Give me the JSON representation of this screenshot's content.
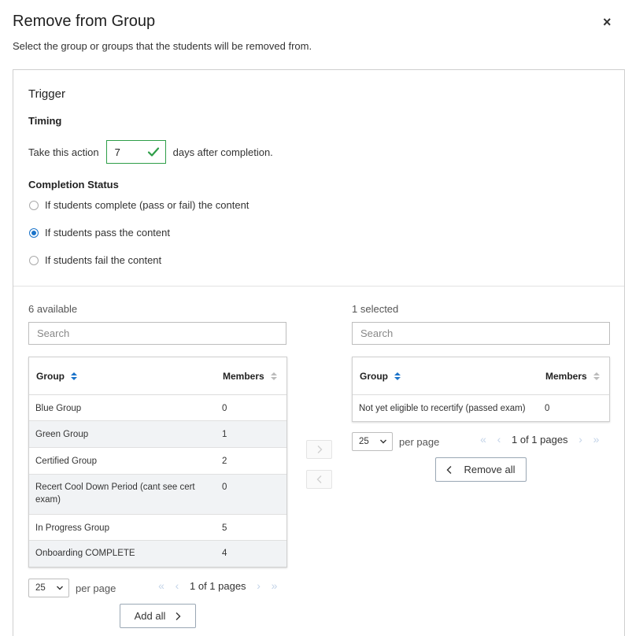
{
  "dialog": {
    "title": "Remove from Group",
    "close": "×",
    "subtitle": "Select the group or groups that the students will be removed from."
  },
  "trigger": {
    "section_label": "Trigger",
    "timing_label": "Timing",
    "action_prefix": "Take this action",
    "days_value": "7",
    "action_suffix": "days after completion.",
    "status_label": "Completion Status",
    "options": [
      {
        "label": "If students complete (pass or fail) the content",
        "selected": false
      },
      {
        "label": "If students pass the content",
        "selected": true
      },
      {
        "label": "If students fail the content",
        "selected": false
      }
    ]
  },
  "available": {
    "count_label": "6 available",
    "search_placeholder": "Search",
    "headers": {
      "group": "Group",
      "members": "Members"
    },
    "rows": [
      {
        "group": "Blue Group",
        "members": "0"
      },
      {
        "group": "Green Group",
        "members": "1"
      },
      {
        "group": "Certified Group",
        "members": "2"
      },
      {
        "group": "Recert Cool Down Period (cant see cert exam)",
        "members": "0"
      },
      {
        "group": "In Progress Group",
        "members": "5"
      },
      {
        "group": "Onboarding COMPLETE",
        "members": "4"
      }
    ],
    "per_page_value": "25",
    "per_page_label": "per page",
    "pages_label": "1 of 1 pages",
    "add_all_label": "Add all"
  },
  "selected": {
    "count_label": "1 selected",
    "search_placeholder": "Search",
    "headers": {
      "group": "Group",
      "members": "Members"
    },
    "rows": [
      {
        "group": "Not yet eligible to recertify (passed exam)",
        "members": "0"
      }
    ],
    "per_page_value": "25",
    "per_page_label": "per page",
    "pages_label": "1 of 1 pages",
    "remove_all_label": "Remove all"
  },
  "colors": {
    "accent": "#1a73c9",
    "success": "#2e9e48",
    "row_alt": "#f1f3f5"
  }
}
